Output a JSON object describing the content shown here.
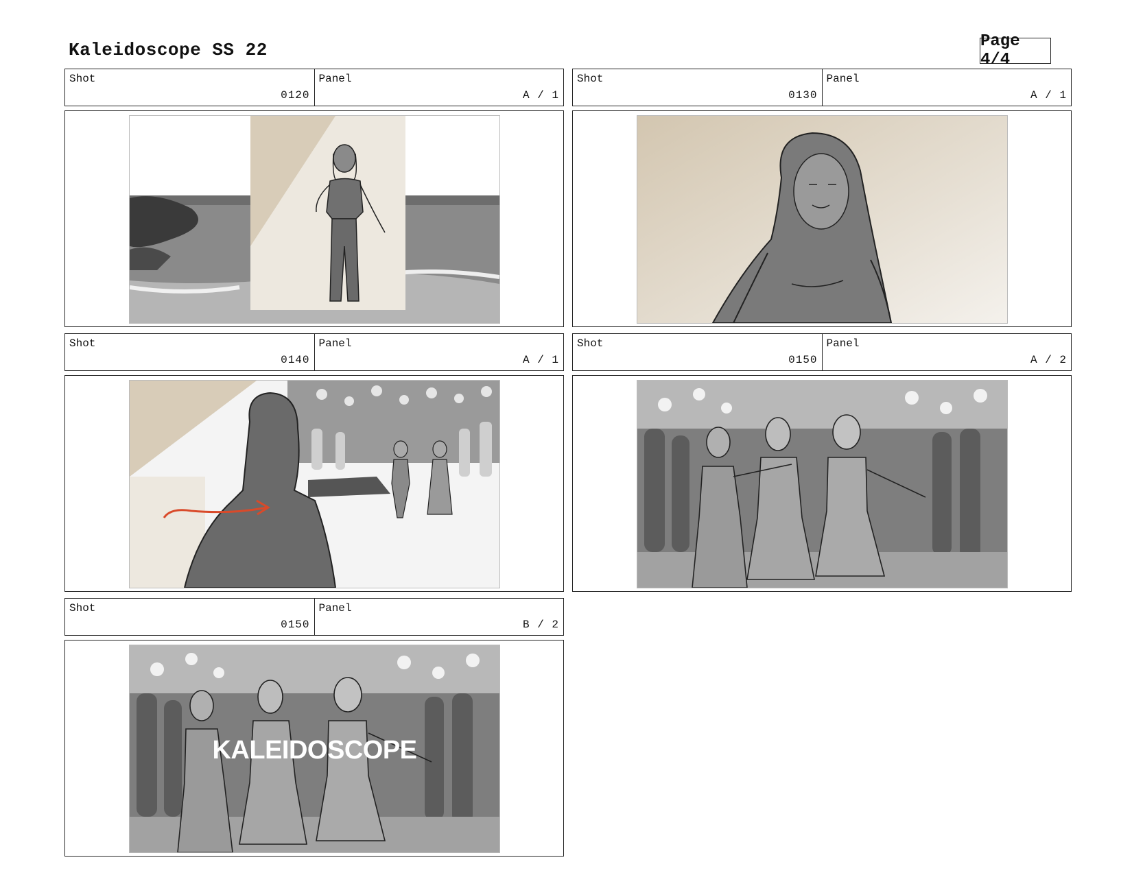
{
  "document": {
    "title": "Kaleidoscope SS 22",
    "page_label": "Page 4/4"
  },
  "labels": {
    "shot": "Shot",
    "panel": "Panel"
  },
  "panels": [
    {
      "shot": "0120",
      "panel": "A / 1",
      "sketch": "woman-on-beach"
    },
    {
      "shot": "0130",
      "panel": "A / 1",
      "sketch": "woman-closeup"
    },
    {
      "shot": "0140",
      "panel": "A / 1",
      "sketch": "woman-walking-to-party"
    },
    {
      "shot": "0150",
      "panel": "A / 2",
      "sketch": "three-women-toasting"
    },
    {
      "shot": "0150",
      "panel": "B / 2",
      "sketch": "three-women-toasting-title",
      "overlay_text": "KALEIDOSCOPE"
    }
  ],
  "colors": {
    "beige": "#d8ccb8",
    "arrow": "#d94a2a",
    "gray_dark": "#6a6a6a",
    "gray_mid": "#9a9a9a"
  }
}
